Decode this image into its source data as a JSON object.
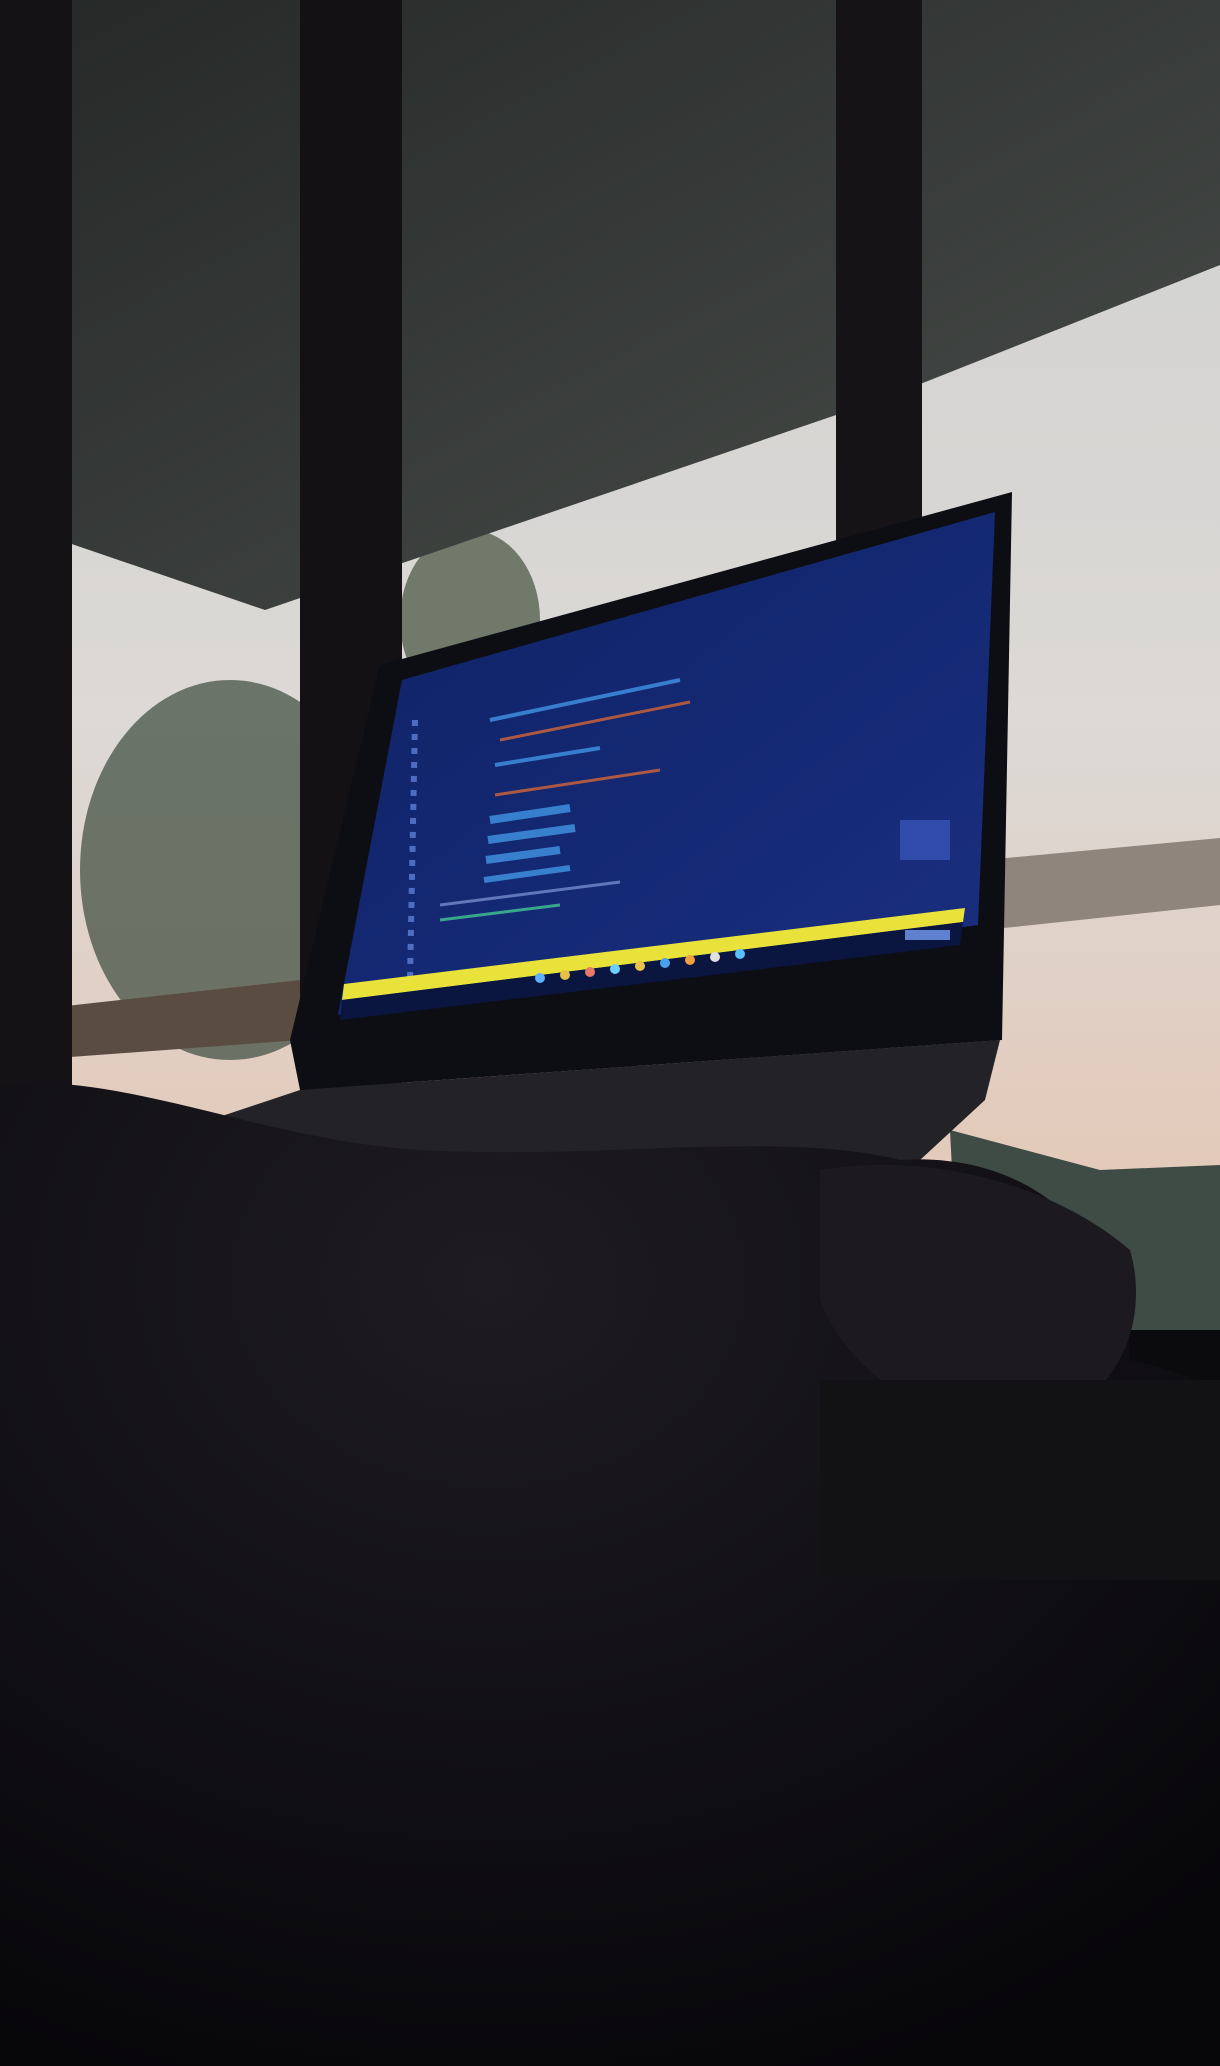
{
  "scene": {
    "subject": "laptop-on-porch",
    "colors": {
      "sky": "#d9d8d6",
      "sky_warm": "#e6cfc0",
      "ceiling": "#3e4240",
      "pillar": "#141214",
      "screen": "#12256b",
      "screen_dark": "#0b1a52",
      "highlight_bar": "#e8e23a",
      "code_blue": "#3f8fe0",
      "code_orange": "#c9623c",
      "blanket": "#1a181d",
      "foreground": "#09080b"
    },
    "icons": [
      "taskbar-app-icons",
      "system-tray-icons"
    ]
  }
}
